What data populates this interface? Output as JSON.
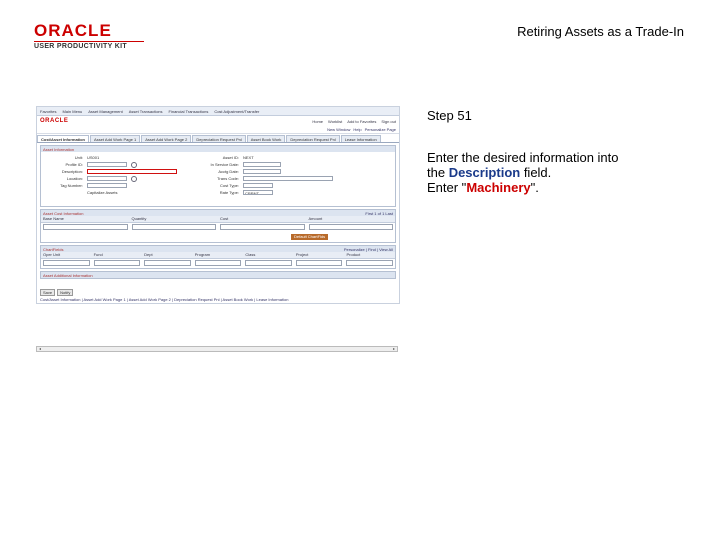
{
  "header": {
    "logo_brand": "ORACLE",
    "logo_sub": "USER PRODUCTIVITY KIT",
    "doc_title": "Retiring Assets as a Trade-In"
  },
  "screenshot": {
    "topnav": [
      "Favorites",
      "Main Menu",
      "Asset Management",
      "Asset Transactions",
      "Financial Transactions",
      "Cost Adjustment/Transfer"
    ],
    "brand": "ORACLE",
    "links": [
      "Home",
      "Worklist",
      "Add to Favorites",
      "Sign out"
    ],
    "subnav": [
      "New Window",
      "Help",
      "Personalize Page"
    ],
    "tabs": [
      "Cost/Asset Information",
      "Asset Add Work Page 1",
      "Asset Add Work Page 2",
      "Depreciation Request Pnl",
      "Asset Book Work",
      "Depreciation Request Pnl",
      "Lease Information"
    ],
    "asset_section": {
      "title": "Asset Information",
      "unit_label": "Unit:",
      "unit_value": "US001",
      "asset_label": "Asset ID:",
      "asset_value": "NEXT",
      "profile_label": "Profile ID:",
      "description_label": "Description:",
      "location_label": "Location:",
      "tag_label": "Tag Number:",
      "in_service_label": "In Service Date:",
      "accounting_label": "Acctg Date:",
      "trans_code_label": "Trans Code:",
      "cost_label": "Cost Type:",
      "rate_label": "Rate Type:",
      "rate_value": "CRRNT",
      "capitalize_label": "Capitalize Assets"
    },
    "cost_section": {
      "title": "Asset Cost Information",
      "nav": "First  1 of 1  Last",
      "columns": [
        "Base Name",
        "Quantity",
        "Cost",
        "Amount"
      ],
      "row1": [
        "CORP",
        "1.000",
        "",
        "USD"
      ],
      "category_label": "Category",
      "cost_type_label": "Cost Type",
      "button": "Default ChartFlds"
    },
    "chartfields": {
      "title": "ChartFields",
      "nav": "Personalize | Find | View All",
      "columns": [
        "Oper Unit",
        "Fund",
        "Dept",
        "Program",
        "Class",
        "Project",
        "Product"
      ]
    },
    "addl_info": "Asset Additional Information",
    "buttons": [
      "Save",
      "Notify"
    ],
    "bottom_links": "Cost/Asset Information | Asset Add Work Page 1 | Asset Add Work Page 2 | Depreciation Request Pnl | Asset Book Work | Lease Information"
  },
  "instructions": {
    "step": "Step 51",
    "line1": "Enter the desired information into",
    "line2_prefix": "the ",
    "field_name": "Description",
    "line2_suffix": " field.",
    "line3_prefix": "Enter \"",
    "value": "Machinery",
    "line3_suffix": "\"."
  }
}
